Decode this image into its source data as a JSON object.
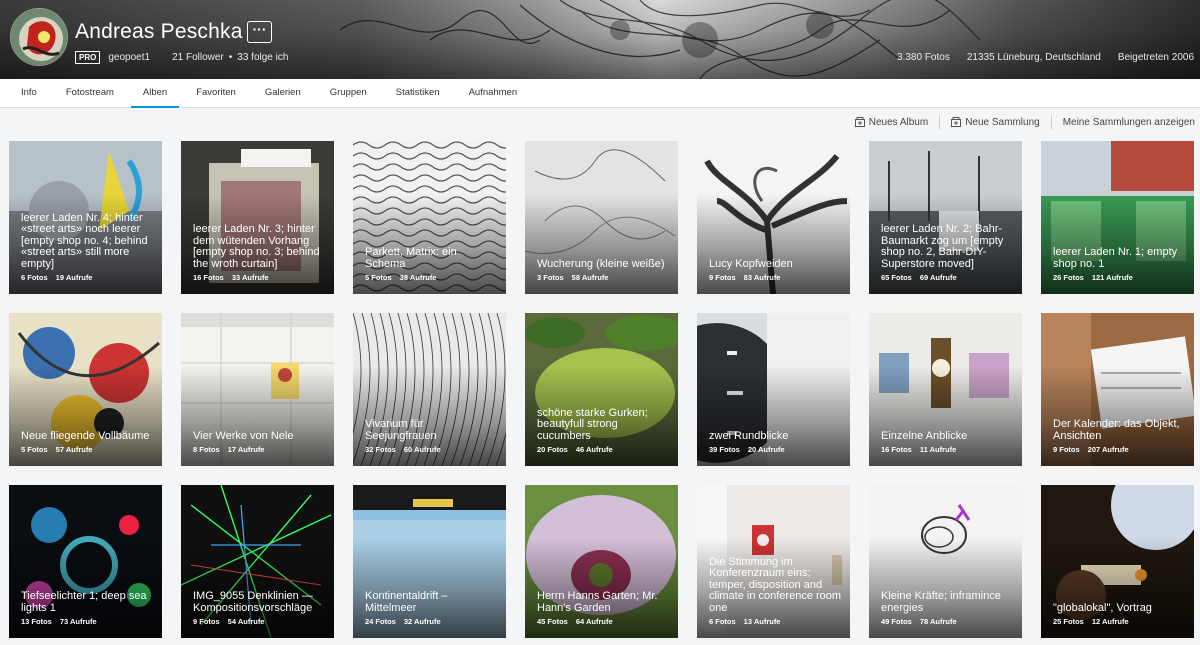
{
  "profile": {
    "name": "Andreas Peschka",
    "more_label": "···",
    "badge": "PRO",
    "username": "geopoet1",
    "followers": "21 Follower",
    "following": "33 folge ich",
    "photos": "3.380 Fotos",
    "location": "21335 Lüneburg, Deutschland",
    "joined": "Beigetreten 2006"
  },
  "tabs": [
    "Info",
    "Fotostream",
    "Alben",
    "Favoriten",
    "Galerien",
    "Gruppen",
    "Statistiken",
    "Aufnahmen"
  ],
  "active_tab": "Alben",
  "actions": {
    "new_album": "Neues Album",
    "new_collection": "Neue Sammlung",
    "show_collections": "Meine Sammlungen anzeigen"
  },
  "albums": [
    {
      "title": "leerer Laden Nr. 4; hinter «street arts» noch leerer [empty shop no. 4; behind «street arts» still more empty]",
      "photos": "6 Fotos",
      "views": "19 Aufrufe"
    },
    {
      "title": "leerer Laden Nr. 3; hinter dem wütenden Vorhang [empty shop no. 3; behind the wroth curtain]",
      "photos": "16 Fotos",
      "views": "33 Aufrufe"
    },
    {
      "title": "Parkett, Matrix: ein Schema",
      "photos": "5 Fotos",
      "views": "38 Aufrufe"
    },
    {
      "title": "Wucherung (kleine weiße)",
      "photos": "3 Fotos",
      "views": "58 Aufrufe"
    },
    {
      "title": "Lucy Kopfweiden",
      "photos": "9 Fotos",
      "views": "83 Aufrufe"
    },
    {
      "title": "leerer Laden Nr. 2; Bahr-Baumarkt zog um [empty shop no. 2, Bahr-DIY-Superstore moved]",
      "photos": "65 Fotos",
      "views": "69 Aufrufe"
    },
    {
      "title": "leerer Laden Nr. 1; empty shop no. 1",
      "photos": "26 Fotos",
      "views": "121 Aufrufe"
    },
    {
      "title": "Neue fliegende Vollbäume",
      "photos": "5 Fotos",
      "views": "57 Aufrufe"
    },
    {
      "title": "Vier Werke von Nele",
      "photos": "8 Fotos",
      "views": "17 Aufrufe"
    },
    {
      "title": "Vivarium für Seejungfrauen",
      "photos": "32 Fotos",
      "views": "60 Aufrufe"
    },
    {
      "title": "schöne starke Gurken; beautyfull strong cucumbers",
      "photos": "20 Fotos",
      "views": "46 Aufrufe"
    },
    {
      "title": "zwei Rundblicke",
      "photos": "39 Fotos",
      "views": "20 Aufrufe"
    },
    {
      "title": "Einzelne Anblicke",
      "photos": "16 Fotos",
      "views": "11 Aufrufe"
    },
    {
      "title": "Der Kalender: das Objekt, Ansichten",
      "photos": "9 Fotos",
      "views": "207 Aufrufe"
    },
    {
      "title": "Tiefseelichter 1; deep sea lights 1",
      "photos": "13 Fotos",
      "views": "73 Aufrufe"
    },
    {
      "title": "IMG_9055 Denklinien — Kompositionsvorschläge",
      "photos": "9 Fotos",
      "views": "54 Aufrufe"
    },
    {
      "title": "Kontinentaldrift – Mittelmeer",
      "photos": "24 Fotos",
      "views": "32 Aufrufe"
    },
    {
      "title": "Herrn Hanns Garten; Mr. Hann's Garden",
      "photos": "45 Fotos",
      "views": "64 Aufrufe"
    },
    {
      "title": "Die Stimmung im Konferenzraum eins; temper, disposition and climate in conference room one",
      "photos": "6 Fotos",
      "views": "13 Aufrufe"
    },
    {
      "title": "Kleine Kräfte; inframince energies",
      "photos": "49 Fotos",
      "views": "78 Aufrufe"
    },
    {
      "title": "\"globalokal\", Vortrag",
      "photos": "25 Fotos",
      "views": "12 Aufrufe"
    }
  ],
  "colors": {
    "accent": "#128fdc",
    "tab_bg": "#ffffff",
    "page_bg": "#f3f5f6"
  }
}
